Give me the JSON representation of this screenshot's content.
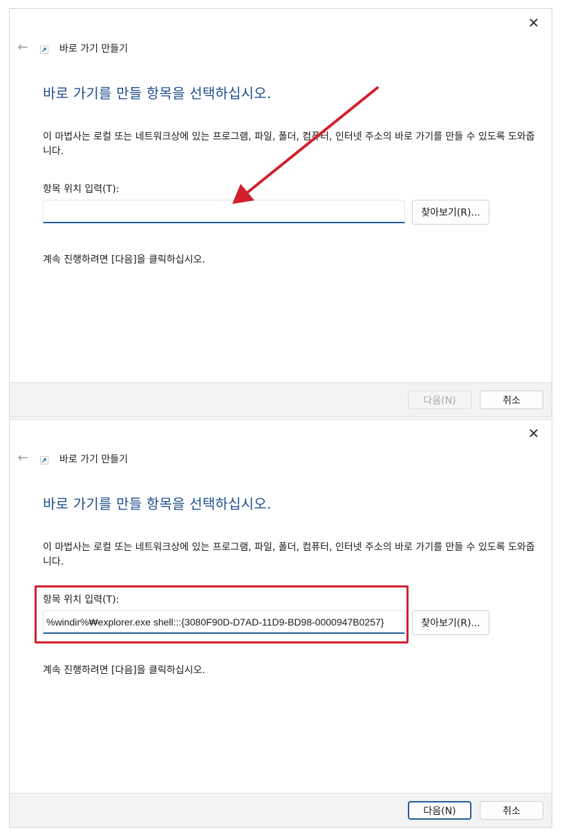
{
  "dialogs": [
    {
      "close_glyph": "✕",
      "back_glyph": "←",
      "title": "바로 가기 만들기",
      "heading": "바로 가기를 만들 항목을 선택하십시오.",
      "description": "이 마법사는 로컬 또는 네트워크상에 있는 프로그램, 파일, 폴더, 컴퓨터, 인터넷 주소의 바로 가기를 만들 수 있도록 도와줍니다.",
      "location_label": "항목 위치 입력(T):",
      "location_value": "",
      "browse_label": "찾아보기(R)...",
      "continue_text": "계속 진행하려면 [다음]을 클릭하십시오.",
      "next_label": "다음(N)",
      "next_enabled": false,
      "cancel_label": "취소"
    },
    {
      "close_glyph": "✕",
      "back_glyph": "←",
      "title": "바로 가기 만들기",
      "heading": "바로 가기를 만들 항목을 선택하십시오.",
      "description": "이 마법사는 로컬 또는 네트워크상에 있는 프로그램, 파일, 폴더, 컴퓨터, 인터넷 주소의 바로 가기를 만들 수 있도록 도와줍니다.",
      "location_label": "항목 위치 입력(T):",
      "location_value": "%windir%₩explorer.exe shell:::{3080F90D-D7AD-11D9-BD98-0000947B0257}",
      "browse_label": "찾아보기(R)...",
      "continue_text": "계속 진행하려면 [다음]을 클릭하십시오.",
      "next_label": "다음(N)",
      "next_enabled": true,
      "cancel_label": "취소"
    }
  ],
  "annotations": {
    "arrow_color": "#d0202c",
    "highlight_color": "#d0202c"
  },
  "colors": {
    "heading": "#1f4e8c",
    "input_focus_border": "#1f5c99",
    "footer_bg": "#f3f3f3"
  }
}
